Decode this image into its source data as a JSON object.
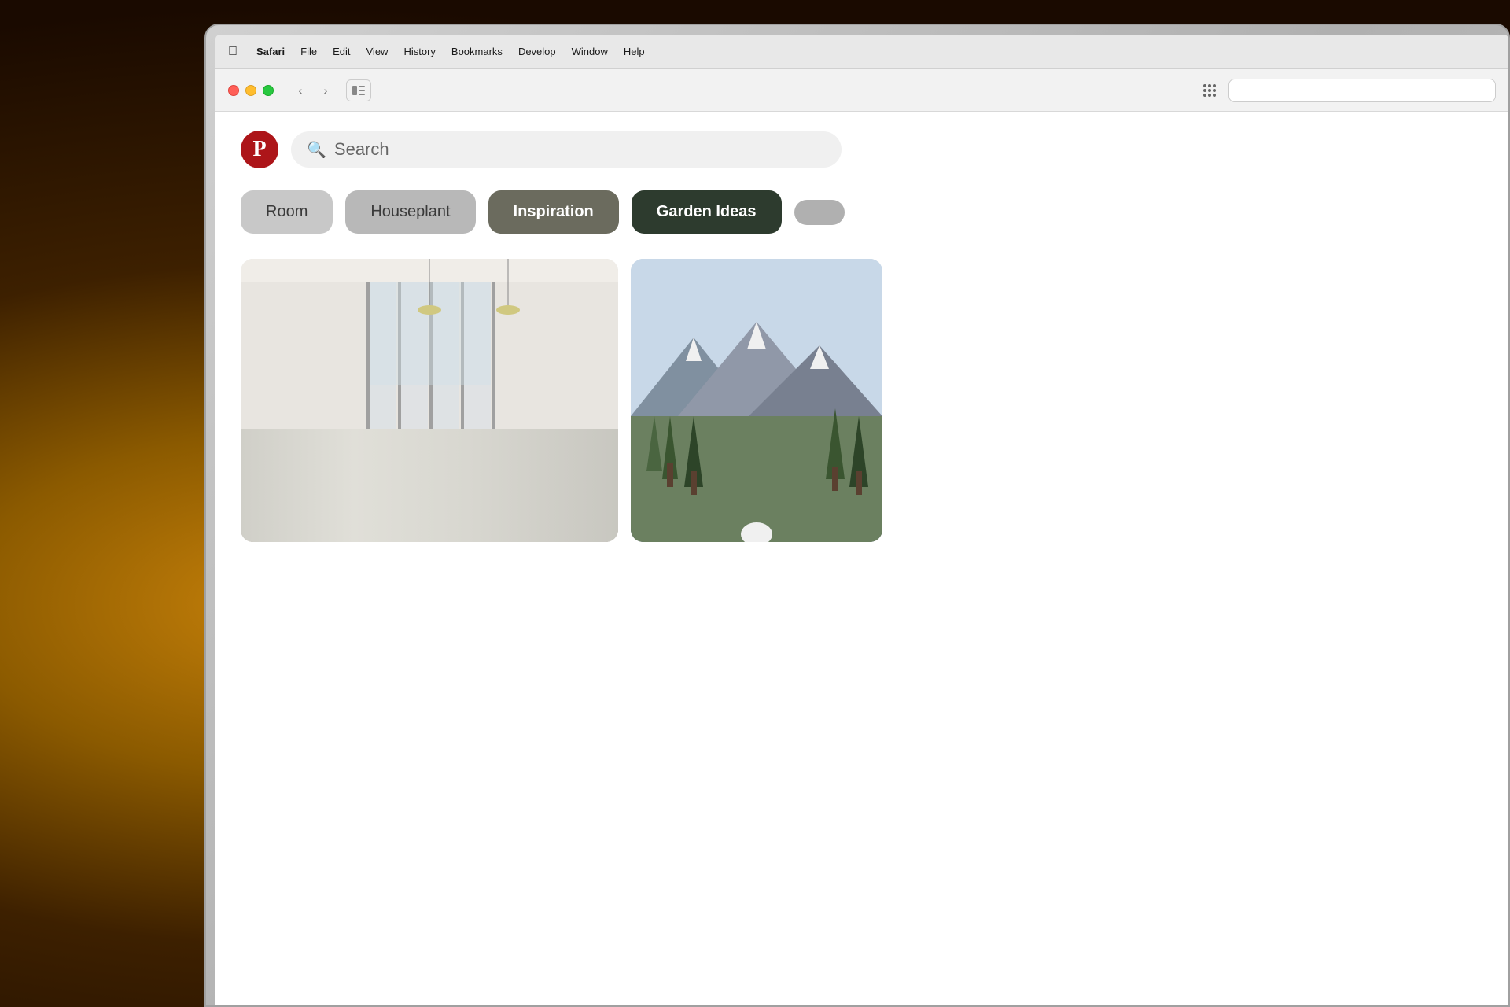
{
  "background": {
    "description": "Warm bokeh background with glowing W light"
  },
  "macos": {
    "menubar": {
      "apple_label": "",
      "items": [
        {
          "label": "Safari",
          "bold": true
        },
        {
          "label": "File"
        },
        {
          "label": "Edit"
        },
        {
          "label": "View"
        },
        {
          "label": "History"
        },
        {
          "label": "Bookmarks"
        },
        {
          "label": "Develop"
        },
        {
          "label": "Window"
        },
        {
          "label": "Help"
        }
      ]
    }
  },
  "browser": {
    "toolbar": {
      "traffic_lights": [
        "red",
        "yellow",
        "green"
      ],
      "back_label": "‹",
      "forward_label": "›",
      "sidebar_icon": "⬜"
    }
  },
  "pinterest": {
    "logo_letter": "P",
    "search_placeholder": "Search",
    "categories": [
      {
        "label": "Room",
        "style": "light-1"
      },
      {
        "label": "Houseplant",
        "style": "light-2"
      },
      {
        "label": "Inspiration",
        "style": "medium"
      },
      {
        "label": "Garden Ideas",
        "style": "dark"
      },
      {
        "label": "",
        "style": "partial"
      }
    ],
    "images": [
      {
        "type": "interior",
        "description": "Modern interior room with folding glass doors"
      },
      {
        "type": "outdoor",
        "description": "Mountain or outdoor landscape with trees"
      }
    ]
  }
}
